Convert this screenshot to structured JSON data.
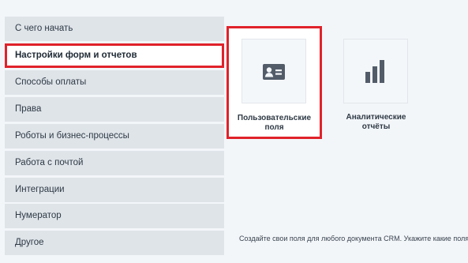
{
  "sidebar": {
    "items": [
      {
        "label": "С чего начать"
      },
      {
        "label": "Настройки форм и отчетов"
      },
      {
        "label": "Способы оплаты"
      },
      {
        "label": "Права"
      },
      {
        "label": "Роботы и бизнес-процессы"
      },
      {
        "label": "Работа с почтой"
      },
      {
        "label": "Интеграции"
      },
      {
        "label": "Нумератор"
      },
      {
        "label": "Другое"
      }
    ],
    "active_index": 1
  },
  "cards": [
    {
      "label_line1": "Пользовательские",
      "label_line2": "поля",
      "icon": "contact-card-icon"
    },
    {
      "label_line1": "Аналитические",
      "label_line2": "отчёты",
      "icon": "bar-chart-icon"
    }
  ],
  "footnote": "Создайте свои поля для любого документа CRM. Укажите какие поля",
  "colors": {
    "highlight": "#e0222a",
    "menu_bg": "#dfe4e9",
    "icon": "#525c69",
    "page_bg": "#f3f6f9"
  }
}
